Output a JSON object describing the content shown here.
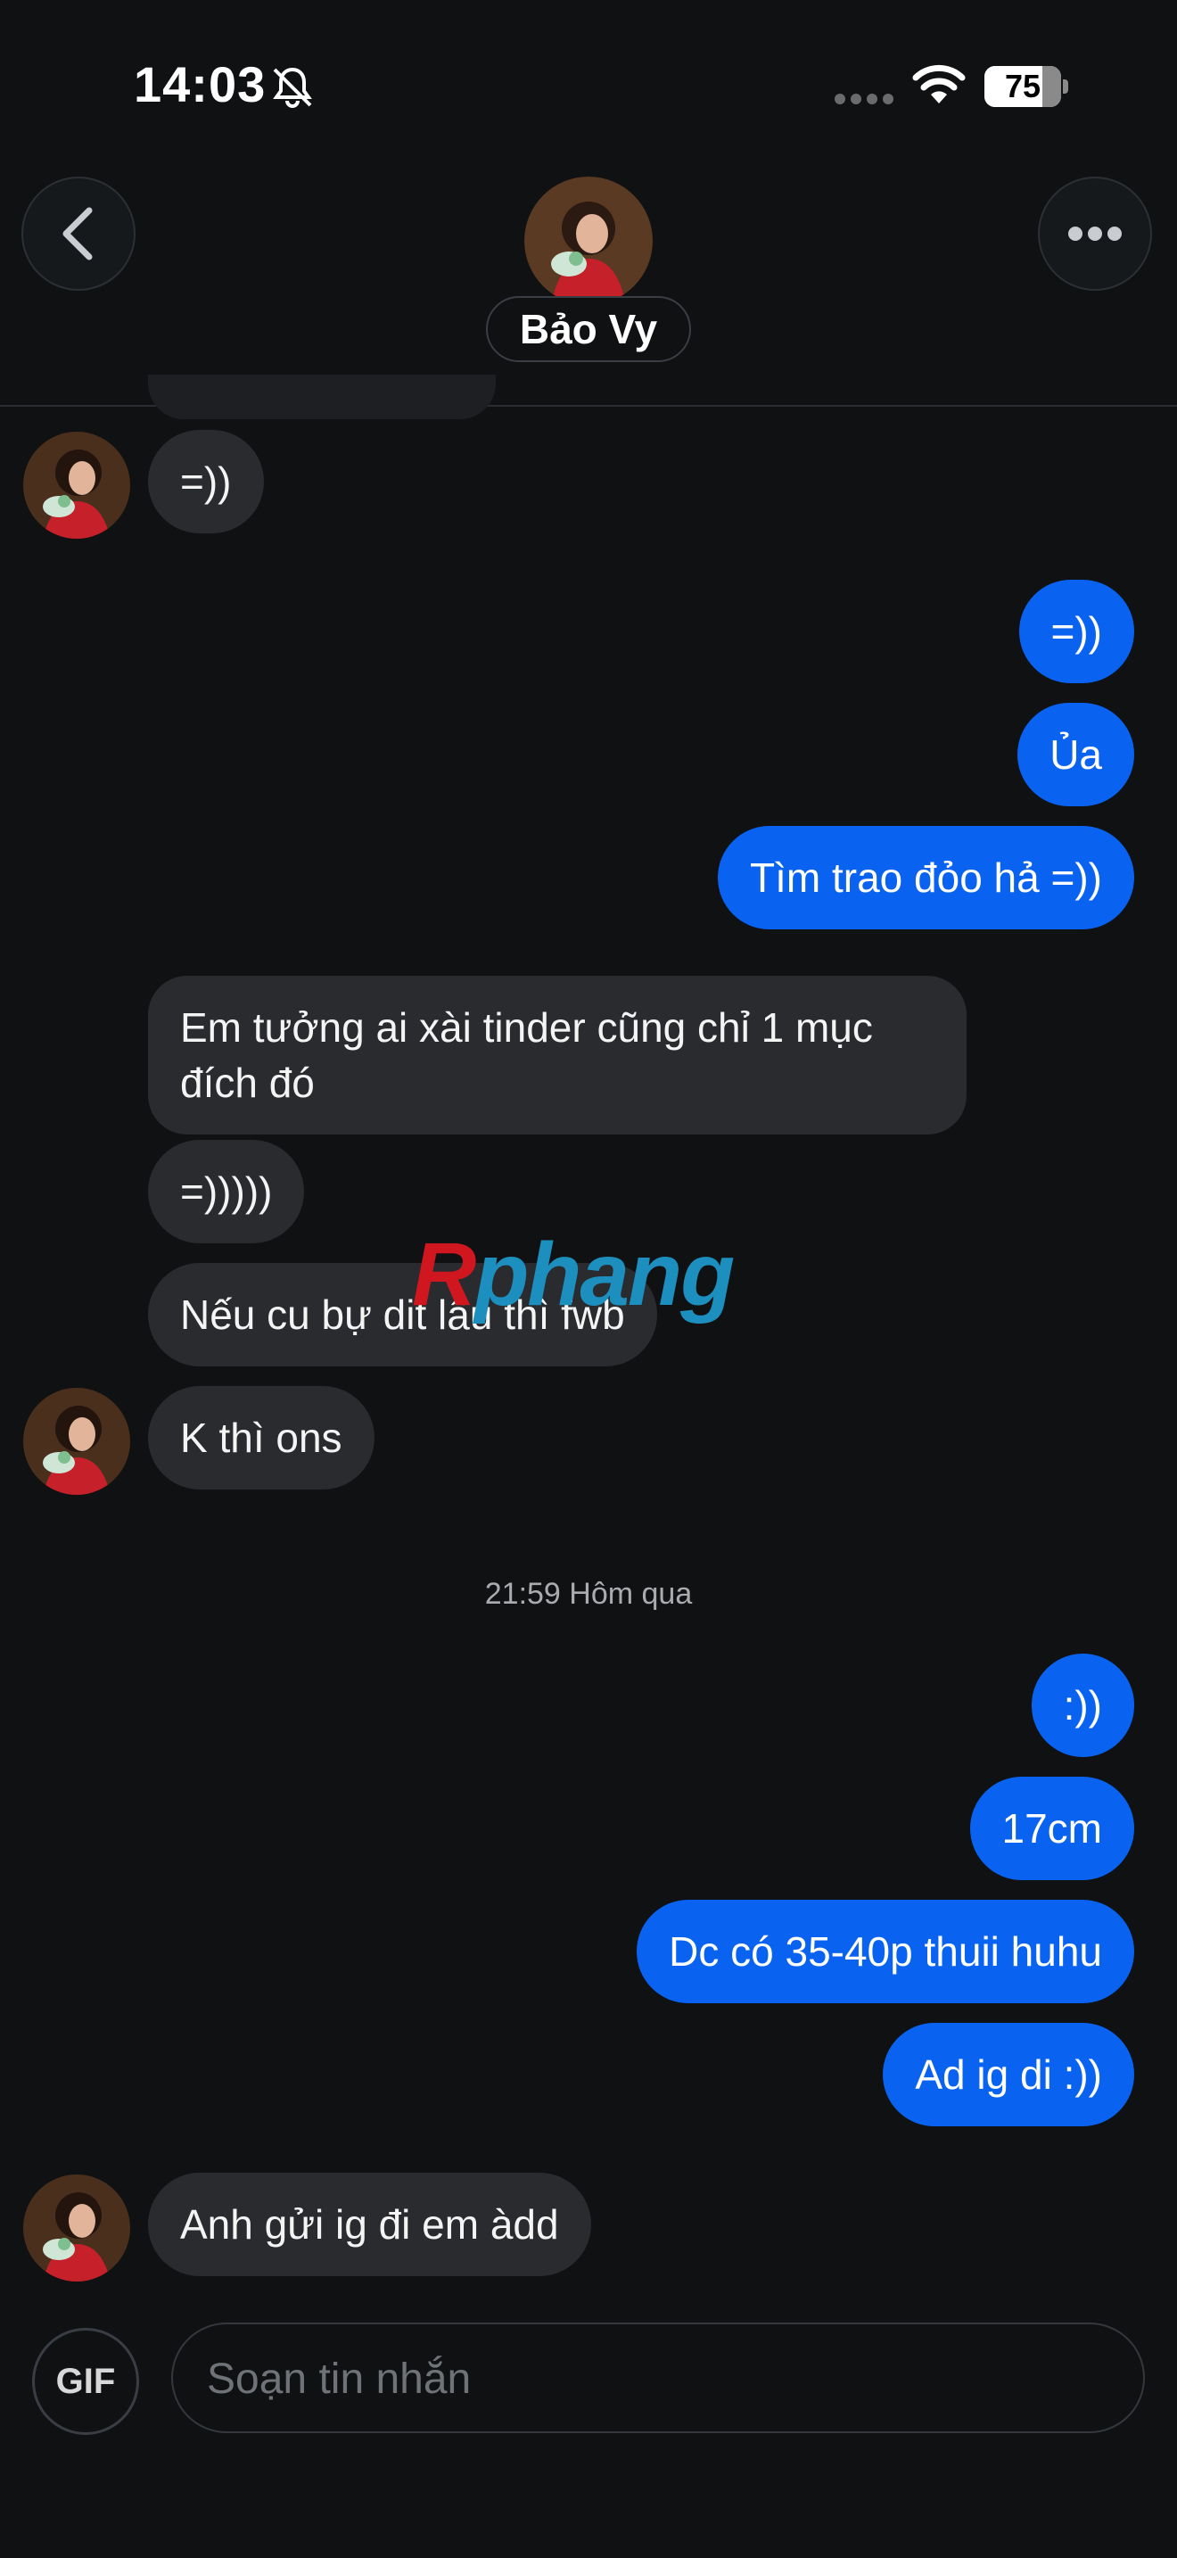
{
  "status_bar": {
    "time": "14:03",
    "battery_level": "75",
    "icons": [
      "bell-slash-icon",
      "signal-dots-icon",
      "wifi-icon",
      "battery-icon"
    ]
  },
  "header": {
    "contact_name": "Bảo Vy",
    "back_icon": "chevron-left-icon",
    "more_icon": "ellipsis-icon"
  },
  "messages": [
    {
      "from": "them",
      "text": "=))"
    },
    {
      "from": "me",
      "text": "=))"
    },
    {
      "from": "me",
      "text": "Ủa"
    },
    {
      "from": "me",
      "text": "Tìm trao đỏo hả =))"
    },
    {
      "from": "them",
      "text": "Em tưởng ai xài tinder cũng chỉ 1 mục đích đó"
    },
    {
      "from": "them",
      "text": "=)))))"
    },
    {
      "from": "them",
      "text": "Nếu cu bự dit lâu thì fwb"
    },
    {
      "from": "them",
      "text": "K thì ons"
    },
    {
      "from": "me",
      "text": ":))"
    },
    {
      "from": "me",
      "text": "17cm"
    },
    {
      "from": "me",
      "text": "Dc có 35-40p thuii huhu"
    },
    {
      "from": "me",
      "text": "Ad ig di :))"
    },
    {
      "from": "them",
      "text": "Anh gửi ig đi em àdd"
    }
  ],
  "timestamp_separator": "21:59 Hôm qua",
  "watermark": {
    "part1": "R",
    "part2": "phang"
  },
  "composer": {
    "gif_label": "GIF",
    "placeholder": "Soạn tin nhắn"
  },
  "colors": {
    "background": "#0f1113",
    "outgoing_bubble": "#0a63f0",
    "incoming_bubble": "#2a2b2f"
  }
}
